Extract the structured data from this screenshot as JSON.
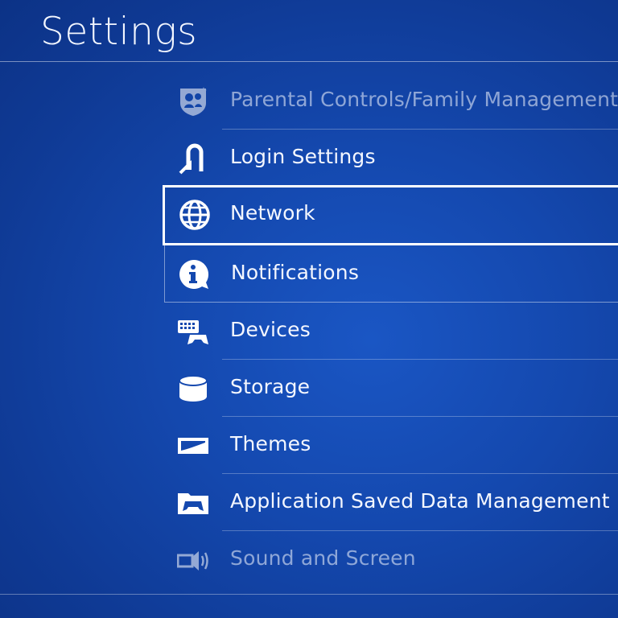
{
  "header": {
    "title": "Settings"
  },
  "menu": {
    "items": [
      {
        "label": "Parental Controls/Family Management",
        "icon": "parental-controls-icon"
      },
      {
        "label": "Login Settings",
        "icon": "login-icon"
      },
      {
        "label": "Network",
        "icon": "globe-icon"
      },
      {
        "label": "Notifications",
        "icon": "info-bubble-icon"
      },
      {
        "label": "Devices",
        "icon": "keyboard-controller-icon"
      },
      {
        "label": "Storage",
        "icon": "storage-cylinder-icon"
      },
      {
        "label": "Themes",
        "icon": "theme-icon"
      },
      {
        "label": "Application Saved Data Management",
        "icon": "saved-data-folder-icon"
      },
      {
        "label": "Sound and Screen",
        "icon": "speaker-icon"
      }
    ],
    "selected_index": 2
  },
  "colors": {
    "background": "#1448ae",
    "text": "#ffffff",
    "selection_border": "#ffffff"
  }
}
